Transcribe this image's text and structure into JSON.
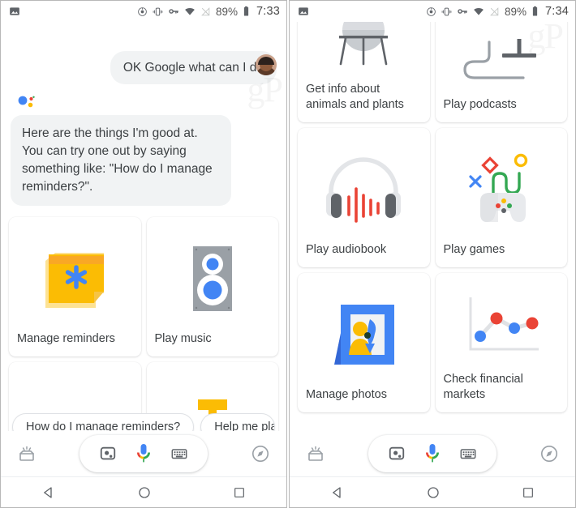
{
  "left_phone": {
    "statusbar": {
      "time": "7:33",
      "battery_pct": "89%",
      "icons": [
        "image-icon",
        "cast-icon",
        "vibrate-icon",
        "vpn-key-icon",
        "wifi-icon",
        "signal-off-icon",
        "battery-icon"
      ]
    },
    "avatar_name": "user-avatar",
    "messages": [
      {
        "role": "user",
        "text": "OK Google what can I do"
      },
      {
        "role": "assistant",
        "text": "Here are the things I'm good at. You can try one out by saying something like: \"How do I manage reminders?\"."
      }
    ],
    "cards": [
      {
        "title": "Manage reminders",
        "icon": "sticky-note-reminder-icon"
      },
      {
        "title": "Play music",
        "icon": "speaker-icon"
      },
      {
        "title": "",
        "icon": "blue-shape-partial-icon"
      },
      {
        "title": "",
        "icon": "yellow-lamp-partial-icon"
      }
    ],
    "chips": [
      {
        "label": "How do I manage reminders?",
        "clipped": false
      },
      {
        "label": "Help me pla",
        "clipped": true
      }
    ],
    "bottombar": {
      "left_icon": "inbox-snapshot-icon",
      "pill": [
        "lens-icon",
        "microphone-icon",
        "keyboard-icon"
      ],
      "right_icon": "explore-compass-icon"
    },
    "navbar": [
      "back-triangle-icon",
      "home-circle-icon",
      "recents-square-icon"
    ]
  },
  "right_phone": {
    "statusbar": {
      "time": "7:34",
      "battery_pct": "89%",
      "icons": [
        "image-icon",
        "cast-icon",
        "vibrate-icon",
        "vpn-key-icon",
        "wifi-icon",
        "signal-off-icon",
        "battery-icon"
      ]
    },
    "cards": [
      {
        "title": "Get info about animals and plants",
        "icon": "plant-stand-icon"
      },
      {
        "title": "Play podcasts",
        "icon": "podcast-mic-icon"
      },
      {
        "title": "Play audiobook",
        "icon": "headphones-waveform-icon"
      },
      {
        "title": "Play games",
        "icon": "game-controller-icon"
      },
      {
        "title": "Manage photos",
        "icon": "photo-frame-icon"
      },
      {
        "title": "Check financial markets",
        "icon": "line-chart-icon"
      }
    ],
    "bottombar": {
      "left_icon": "inbox-snapshot-icon",
      "pill": [
        "lens-icon",
        "microphone-icon",
        "keyboard-icon"
      ],
      "right_icon": "explore-compass-icon"
    },
    "navbar": [
      "back-triangle-icon",
      "home-circle-icon",
      "recents-square-icon"
    ]
  },
  "colors": {
    "google_blue": "#4285F4",
    "google_red": "#EA4335",
    "google_yellow": "#FBBC05",
    "google_green": "#34A853",
    "bubble_bg": "#F1F3F4",
    "text": "#3C4043",
    "card_bg": "#FFFFFF",
    "reminder_orange": "#FBBC04",
    "speaker_grey": "#9AA0A6"
  },
  "watermark": "gP"
}
